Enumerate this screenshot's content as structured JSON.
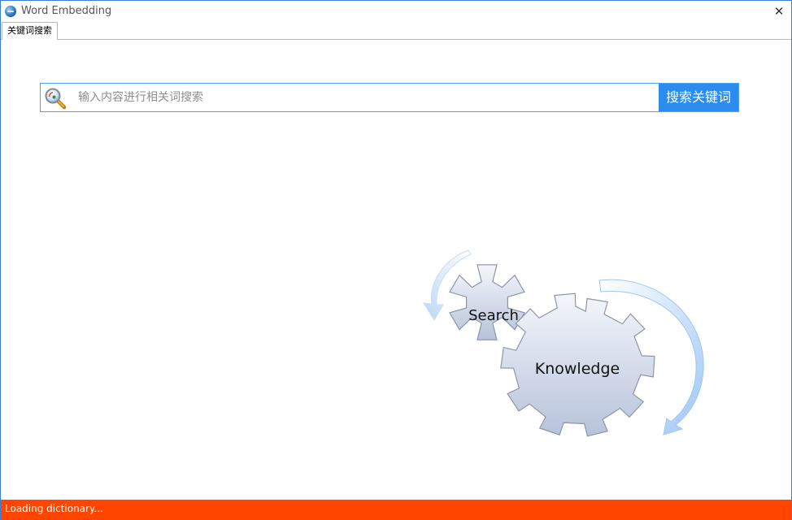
{
  "window": {
    "title": "Word Embedding",
    "close_glyph": "✕",
    "app_icon": "globe-icon"
  },
  "tabs": [
    {
      "label": "关键词搜索",
      "active": true
    }
  ],
  "search": {
    "icon": "magnifier-icon",
    "placeholder": "输入内容进行相关词搜索",
    "value": "",
    "button_label": "搜索关键词"
  },
  "illustration": {
    "small_gear_label": "Search",
    "large_gear_label": "Knowledge"
  },
  "status": {
    "text": "Loading dictionary...",
    "color": "#ff4500"
  },
  "colors": {
    "accent": "#2d8cf0",
    "border": "#4aa3f0"
  }
}
